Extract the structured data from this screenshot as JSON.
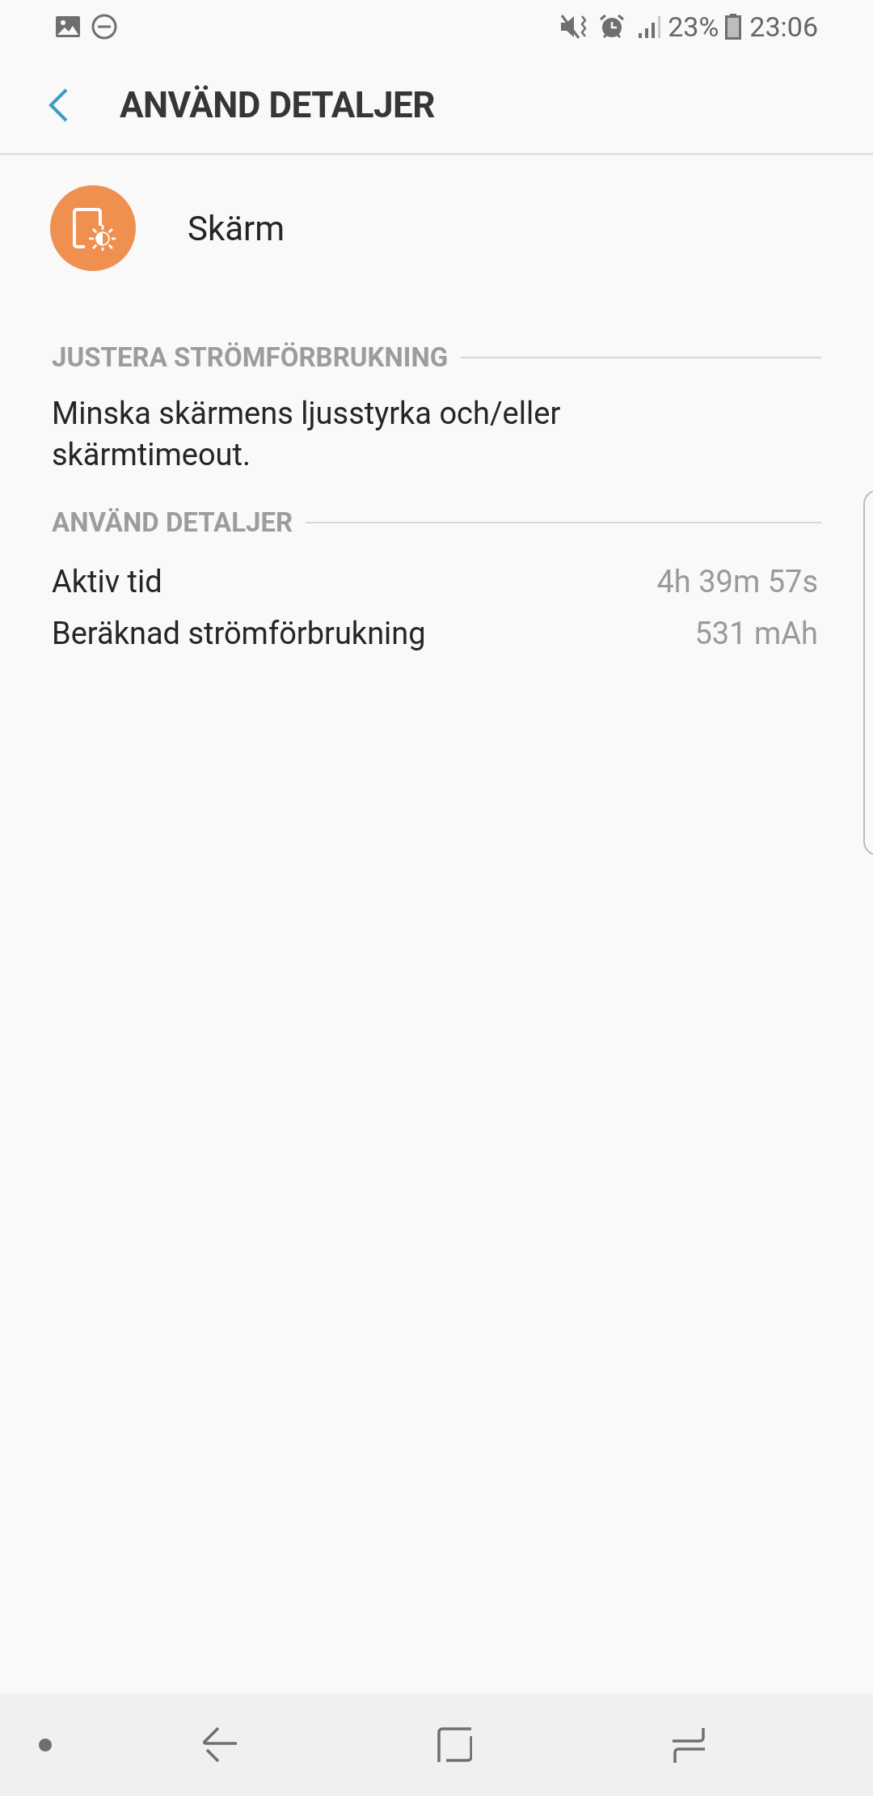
{
  "status_bar": {
    "battery_percent": "23%",
    "time": "23:06"
  },
  "app_bar": {
    "title": "ANVÄND DETALJER"
  },
  "app": {
    "name": "Skärm"
  },
  "sections": [
    {
      "header": "JUSTERA STRÖMFÖRBRUKNING",
      "text": "Minska skärmens ljusstyrka och/eller skärmtimeout."
    },
    {
      "header": "ANVÄND DETALJER",
      "rows": [
        {
          "label": "Aktiv tid",
          "value": "4h 39m 57s"
        },
        {
          "label": "Beräknad strömförbrukning",
          "value": "531 mAh"
        }
      ]
    }
  ]
}
